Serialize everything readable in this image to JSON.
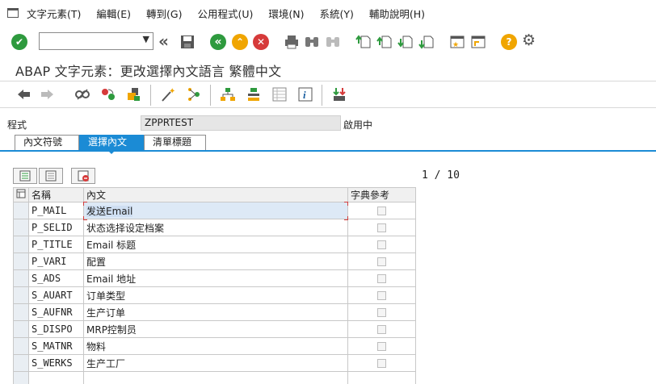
{
  "menu": [
    "文字元素(T)",
    "編輯(E)",
    "轉到(G)",
    "公用程式(U)",
    "環境(N)",
    "系統(Y)",
    "輔助說明(H)"
  ],
  "title": "ABAP 文字元素：更改選擇內文語言 繁體中文",
  "program": {
    "label": "程式",
    "value": "ZPPRTEST",
    "status": "啟用中"
  },
  "tabs": [
    "內文符號",
    "選擇內文",
    "清單標題"
  ],
  "pager": "1 / 10",
  "table": {
    "headers": [
      "名稱",
      "內文",
      "字典參考"
    ],
    "rows": [
      {
        "name": "P_MAIL",
        "text": "发送Email"
      },
      {
        "name": "P_SELID",
        "text": "状态选择设定档案"
      },
      {
        "name": "P_TITLE",
        "text": "Email 标题"
      },
      {
        "name": "P_VARI",
        "text": "配置"
      },
      {
        "name": "S_ADS",
        "text": "Email 地址"
      },
      {
        "name": "S_AUART",
        "text": "订单类型"
      },
      {
        "name": "S_AUFNR",
        "text": "生产订单"
      },
      {
        "name": "S_DISPO",
        "text": "MRP控制员"
      },
      {
        "name": "S_MATNR",
        "text": "物料"
      },
      {
        "name": "S_WERKS",
        "text": "生产工厂"
      }
    ]
  },
  "colors": {
    "accent": "#1b8bd5",
    "confirm": "#2e9a3e",
    "nav": "#f0a500",
    "cancel": "#d63a3a",
    "help": "#f0a500"
  }
}
